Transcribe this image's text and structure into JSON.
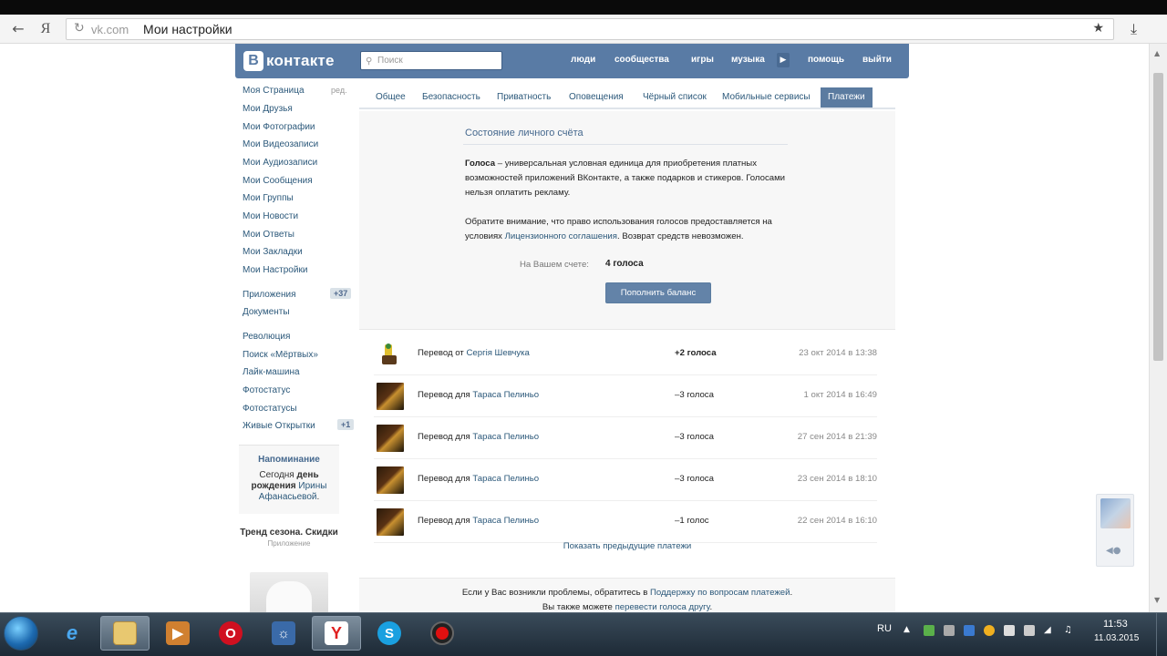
{
  "browser": {
    "url_domain": "vk.com",
    "page_title": "Мои настройки",
    "yandex_label": "Я"
  },
  "header": {
    "logo_letter": "В",
    "logo_text": "контакте",
    "search_placeholder": "Поиск",
    "nav": [
      "люди",
      "сообщества",
      "игры",
      "музыка",
      "помощь",
      "выйти"
    ]
  },
  "sidebar": {
    "edit_label": "ред.",
    "items": [
      "Моя Страница",
      "Мои Друзья",
      "Мои Фотографии",
      "Мои Видеозаписи",
      "Мои Аудиозаписи",
      "Мои Сообщения",
      "Мои Группы",
      "Мои Новости",
      "Мои Ответы",
      "Мои Закладки",
      "Мои Настройки"
    ],
    "apps_label": "Приложения",
    "apps_badge": "+37",
    "docs_label": "Документы",
    "app_items": [
      "Революция",
      "Поиск «Мёртвых»",
      "Лайк-машина",
      "Фотостатус",
      "Фотостатусы",
      "Живые Открытки"
    ],
    "live_cards_badge": "+1",
    "reminder_title": "Напоминание",
    "reminder_pre": "Сегодня ",
    "reminder_bold": "день рождения",
    "reminder_link": "Ирины Афанасьевой",
    "reminder_post": ".",
    "ad_title": "Тренд сезона. Скидки",
    "ad_sub": "Приложение"
  },
  "tabs": [
    "Общее",
    "Безопасность",
    "Приватность",
    "Оповещения",
    "Чёрный список",
    "Мобильные сервисы"
  ],
  "active_tab": "Платежи",
  "account": {
    "title": "Состояние личного счёта",
    "p1_bold": "Голоса",
    "p1_text": " – универсальная условная единица для приобретения платных возможностей приложений ВКонтакте, а также подарков и стикеров. Голосами нельзя оплатить рекламу.",
    "p2_pre": "Обратите внимание, что право использования голосов предоставляется на условиях ",
    "p2_link": "Лицензионного соглашения",
    "p2_post": ". Возврат средств невозможен.",
    "balance_label": "На Вашем счете:",
    "balance_value": "4 голоса",
    "topup_button": "Пополнить баланс"
  },
  "transactions": [
    {
      "prefix": "Перевод от ",
      "name": "Сергія Шевчука",
      "amount": "+2 голоса",
      "date": "23 окт 2014 в 13:38",
      "thumb": "light"
    },
    {
      "prefix": "Перевод для ",
      "name": "Тараса Пелиньо",
      "amount": "–3 голоса",
      "date": "1 окт 2014 в 16:49",
      "thumb": "dark"
    },
    {
      "prefix": "Перевод для ",
      "name": "Тараса Пелиньо",
      "amount": "–3 голоса",
      "date": "27 сен 2014 в 21:39",
      "thumb": "dark"
    },
    {
      "prefix": "Перевод для ",
      "name": "Тараса Пелиньо",
      "amount": "–3 голоса",
      "date": "23 сен 2014 в 18:10",
      "thumb": "dark"
    },
    {
      "prefix": "Перевод для ",
      "name": "Тараса Пелиньо",
      "amount": "–1 голос",
      "date": "22 сен 2014 в 16:10",
      "thumb": "dark"
    }
  ],
  "show_previous": "Показать предыдущие платежи",
  "footer": {
    "line1_pre": "Если у Вас возникли проблемы, обратитесь в ",
    "line1_link": "Поддержку по вопросам платежей",
    "line1_post": ".",
    "line2_pre": "Вы также можете ",
    "line2_link": "перевести голоса другу",
    "line2_post": "."
  },
  "taskbar": {
    "apps": [
      "internet-explorer",
      "explorer",
      "media-player",
      "opera",
      "network",
      "yandex-browser",
      "skype",
      "recorder"
    ],
    "lang": "RU",
    "time": "11:53",
    "date": "11.03.2015"
  },
  "colors": {
    "vk_blue": "#597ba5",
    "link": "#2b587a",
    "active_tab": "#5b7ba0",
    "button": "#6383a8"
  }
}
